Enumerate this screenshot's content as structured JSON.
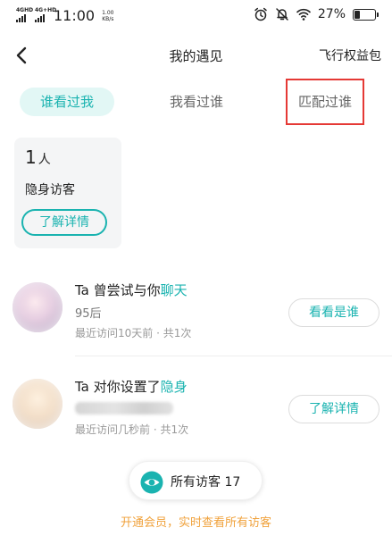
{
  "status_bar": {
    "net1": "4G",
    "net1_sup": "HD",
    "net2": "4G+",
    "net2_sup": "HD",
    "time": "11:00",
    "speed_value": "1.00",
    "speed_unit": "KB/s",
    "battery_percent": "27%",
    "battery_level": 0.27,
    "icons": [
      "alarm-icon",
      "mute-bell-icon",
      "wifi-icon",
      "battery-icon"
    ]
  },
  "header": {
    "back_icon": "chevron-left-icon",
    "title": "我的遇见",
    "right_link": "飞行权益包"
  },
  "tabs": [
    {
      "label": "谁看过我",
      "active": true
    },
    {
      "label": "我看过谁",
      "active": false
    },
    {
      "label": "匹配过谁",
      "active": false
    }
  ],
  "anon_card": {
    "count": "1",
    "unit": "人",
    "label": "隐身访客",
    "button": "了解详情"
  },
  "visitors": [
    {
      "title_prefix": "Ta 曾尝试与你",
      "title_highlight": "聊天",
      "subtitle": "95后",
      "time": "最近访问10天前 · 共1次",
      "button": "看看是谁"
    },
    {
      "title_prefix": "Ta 对你设置了",
      "title_highlight": "隐身",
      "subtitle": "",
      "time": "最近访问几秒前 · 共1次",
      "button": "了解详情"
    }
  ],
  "all_visitors": {
    "label": "所有访客 17",
    "icon": "eye-icon"
  },
  "promo_text": "开通会员，实时查看所有访客",
  "colors": {
    "accent": "#1ab3b0",
    "accent_bg": "#e2f7f5",
    "promo": "#f0a23c",
    "highlight_box": "#e53935"
  }
}
